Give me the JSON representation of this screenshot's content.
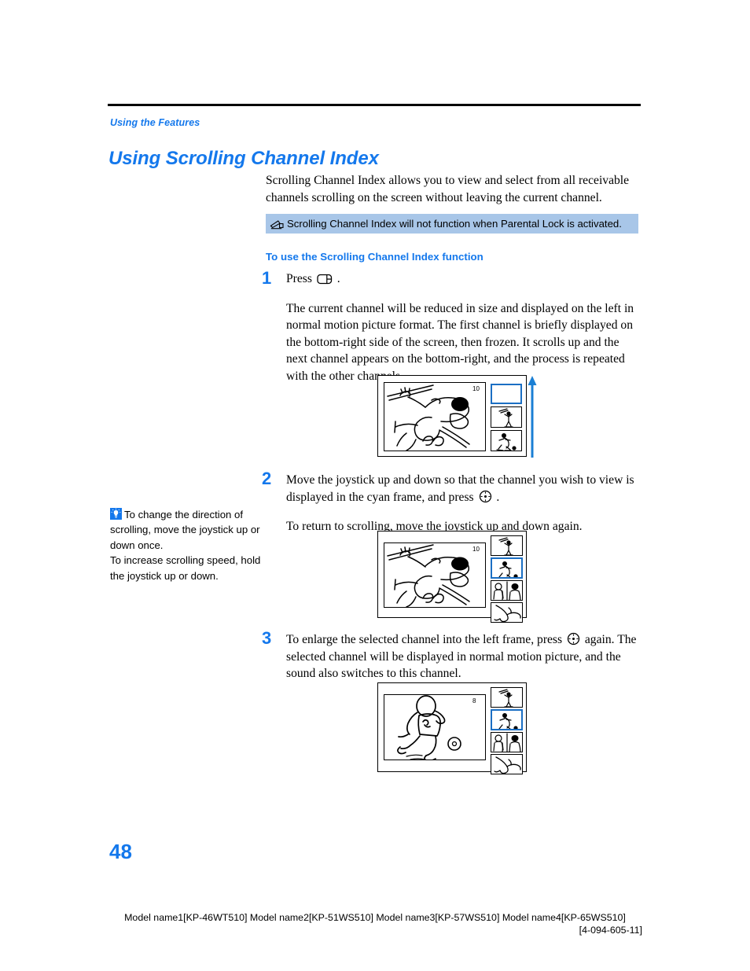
{
  "header": {
    "running_head": "Using the Features",
    "chapter_title": "Using Scrolling Channel Index",
    "accent_color": "#1478EC"
  },
  "intro": {
    "text": "Scrolling Channel Index allows you to view and select from all receivable channels scrolling on the screen without leaving the current channel."
  },
  "note": {
    "icon": "note-pencil-icon",
    "text": "Scrolling Channel Index will not function when Parental Lock is activated.",
    "background_color": "#A8C6E8"
  },
  "sub_heading": "To use the Scrolling Channel Index function",
  "steps": [
    {
      "number": "1",
      "lead_before": "Press",
      "icon": "index-button-icon",
      "lead_after": ".",
      "paragraph": "The current channel will be reduced in size and displayed on the left in normal motion picture format. The first channel is briefly displayed on the bottom-right side of the screen, then frozen. It scrolls up and the next channel appears on the bottom-right, and the process is repeated with the other channels."
    },
    {
      "number": "2",
      "text_before": "Move the joystick up and down so that the channel you wish to view is displayed in the cyan frame, and press",
      "icon": "joystick-icon",
      "text_after": ".",
      "paragraph": "To return to scrolling, move the joystick up and down again."
    },
    {
      "number": "3",
      "text_before": "To enlarge the selected channel into the left frame, press",
      "icon": "joystick-icon",
      "text_after": "again.",
      "paragraph": "The selected channel will be displayed in normal motion picture, and the sound also switches to this channel."
    }
  ],
  "tip": {
    "icon": "lightbulb-tip-icon",
    "line1": "To change the direction of scrolling, move the joystick up or down once.",
    "line2": "To increase scrolling speed, hold the joystick up or down."
  },
  "figures": [
    {
      "name": "figure-step-1",
      "channel_number": "10",
      "main_image": "baseball-batter-drawing",
      "scroll_arrow": "up-arrow",
      "thumbnails": [
        {
          "image": "empty-frame",
          "selected": true
        },
        {
          "image": "golfer-drawing",
          "selected": false
        },
        {
          "image": "soccer-player-drawing",
          "selected": false
        }
      ]
    },
    {
      "name": "figure-step-2",
      "channel_number": "10",
      "main_image": "baseball-batter-drawing",
      "thumbnails": [
        {
          "image": "golfer-drawing",
          "selected": false
        },
        {
          "image": "soccer-player-drawing",
          "selected": true
        },
        {
          "image": "news-interview-drawing",
          "selected": false
        },
        {
          "image": "dolphin-drawing",
          "selected": false
        }
      ]
    },
    {
      "name": "figure-step-3",
      "channel_number": "8",
      "main_image": "soccer-player-drawing",
      "thumbnails": [
        {
          "image": "golfer-drawing",
          "selected": false
        },
        {
          "image": "soccer-player-drawing",
          "selected": true
        },
        {
          "image": "news-interview-drawing",
          "selected": false
        },
        {
          "image": "dolphin-drawing",
          "selected": false
        }
      ]
    }
  ],
  "page_number": "48",
  "footer": {
    "models": "Model name1[KP-46WT510] Model name2[KP-51WS510] Model name3[KP-57WS510] Model name4[KP-65WS510]",
    "doc_number": "[4-094-605-11]"
  }
}
